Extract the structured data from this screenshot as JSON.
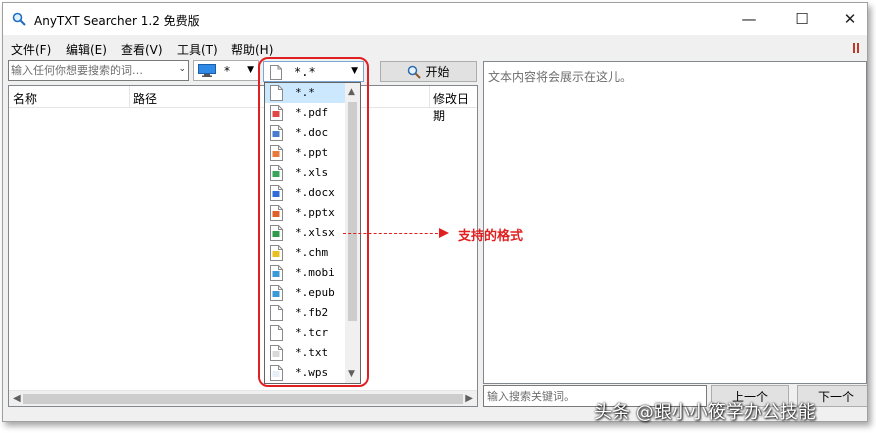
{
  "window": {
    "title": "AnyTXT Searcher 1.2 免费版",
    "controls": {
      "minimize": "—",
      "maximize": "☐",
      "close": "✕"
    }
  },
  "menu": [
    {
      "label": "文件(F)"
    },
    {
      "label": "编辑(E)"
    },
    {
      "label": "查看(V)"
    },
    {
      "label": "工具(T)"
    },
    {
      "label": "帮助(H)"
    }
  ],
  "toolbar": {
    "search_placeholder": "输入任何你想要搜索的词…",
    "drive_value": "*",
    "format_value": "*.*",
    "start_label": "开始"
  },
  "results": {
    "columns": {
      "name": "名称",
      "path": "路径",
      "modified": "修改日期"
    }
  },
  "preview": {
    "placeholder": "文本内容将会展示在这儿。",
    "keyword_placeholder": "输入搜索关键词。",
    "prev_label": "上一个",
    "next_label": "下一个"
  },
  "format_dropdown": {
    "selected_index": 0,
    "items": [
      {
        "label": "*.*",
        "icon": "generic-file-icon",
        "color": "#ffffff"
      },
      {
        "label": "*.pdf",
        "icon": "pdf-file-icon",
        "color": "#e04848"
      },
      {
        "label": "*.doc",
        "icon": "doc-file-icon",
        "color": "#4a7bd0"
      },
      {
        "label": "*.ppt",
        "icon": "ppt-file-icon",
        "color": "#e87a3a"
      },
      {
        "label": "*.xls",
        "icon": "xls-file-icon",
        "color": "#3aa55a"
      },
      {
        "label": "*.docx",
        "icon": "docx-file-icon",
        "color": "#2f6cd8"
      },
      {
        "label": "*.pptx",
        "icon": "pptx-file-icon",
        "color": "#e0602a"
      },
      {
        "label": "*.xlsx",
        "icon": "xlsx-file-icon",
        "color": "#2e9a4a"
      },
      {
        "label": "*.chm",
        "icon": "chm-file-icon",
        "color": "#e8c020"
      },
      {
        "label": "*.mobi",
        "icon": "mobi-file-icon",
        "color": "#3a9ad8"
      },
      {
        "label": "*.epub",
        "icon": "epub-file-icon",
        "color": "#3a9ad8"
      },
      {
        "label": "*.fb2",
        "icon": "fb2-file-icon",
        "color": "#ffffff"
      },
      {
        "label": "*.tcr",
        "icon": "tcr-file-icon",
        "color": "#ffffff"
      },
      {
        "label": "*.txt",
        "icon": "txt-file-icon",
        "color": "#d8d8d8"
      },
      {
        "label": "*.wps",
        "icon": "wps-file-icon",
        "color": "#e8eef8"
      }
    ]
  },
  "annotation": {
    "text": "支持的格式",
    "color": "#e02020"
  },
  "watermark": "头条 @跟小小筱学办公技能"
}
